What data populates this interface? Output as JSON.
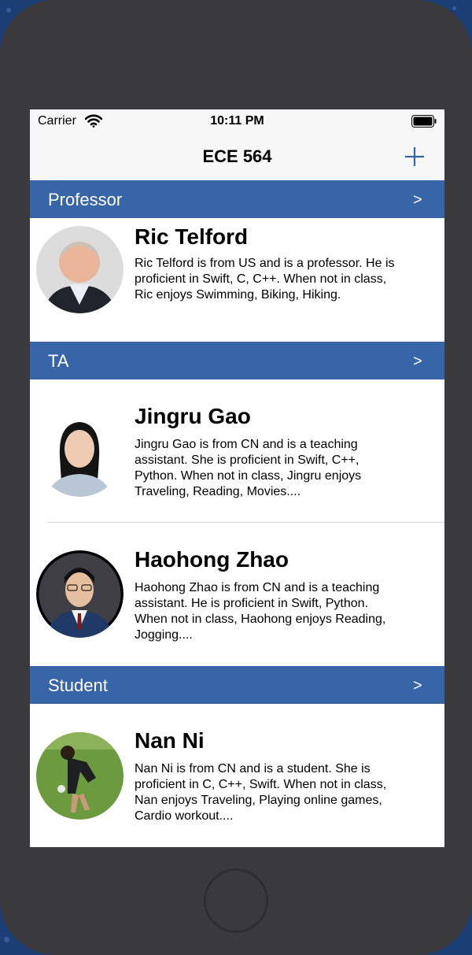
{
  "status_bar": {
    "carrier": "Carrier",
    "time": "10:11 PM"
  },
  "nav": {
    "title": "ECE 564",
    "add_icon": "plus-icon"
  },
  "sections": [
    {
      "title": "Professor",
      "chevron": ">"
    },
    {
      "title": "TA",
      "chevron": ">"
    },
    {
      "title": "Student",
      "chevron": ">"
    }
  ],
  "people": [
    {
      "name": "Ric Telford",
      "lines": [
        "Ric Telford is from US and is a professor. He is",
        "proficient in Swift, C, C++. When not in class,",
        "Ric enjoys Swimming, Biking, Hiking."
      ]
    },
    {
      "name": "Jingru Gao",
      "lines": [
        "Jingru Gao is from CN and is a teaching",
        "assistant. She is proficient in Swift, C++,",
        "Python. When not in class, Jingru enjoys",
        "Traveling, Reading, Movies...."
      ]
    },
    {
      "name": "Haohong Zhao",
      "lines": [
        "Haohong Zhao is from CN and is a teaching",
        "assistant. He is proficient in Swift, Python.",
        "When not in class, Haohong enjoys Reading,",
        "Jogging...."
      ]
    },
    {
      "name": "Nan Ni",
      "lines": [
        "Nan Ni is from CN and is a student. She is",
        "proficient in C, C++, Swift. When not in class,",
        "Nan enjoys Traveling, Playing online games,",
        "Cardio workout...."
      ]
    }
  ],
  "colors": {
    "section_header": "#3765a8",
    "tint": "#3765a8",
    "device": "#3a393b"
  }
}
